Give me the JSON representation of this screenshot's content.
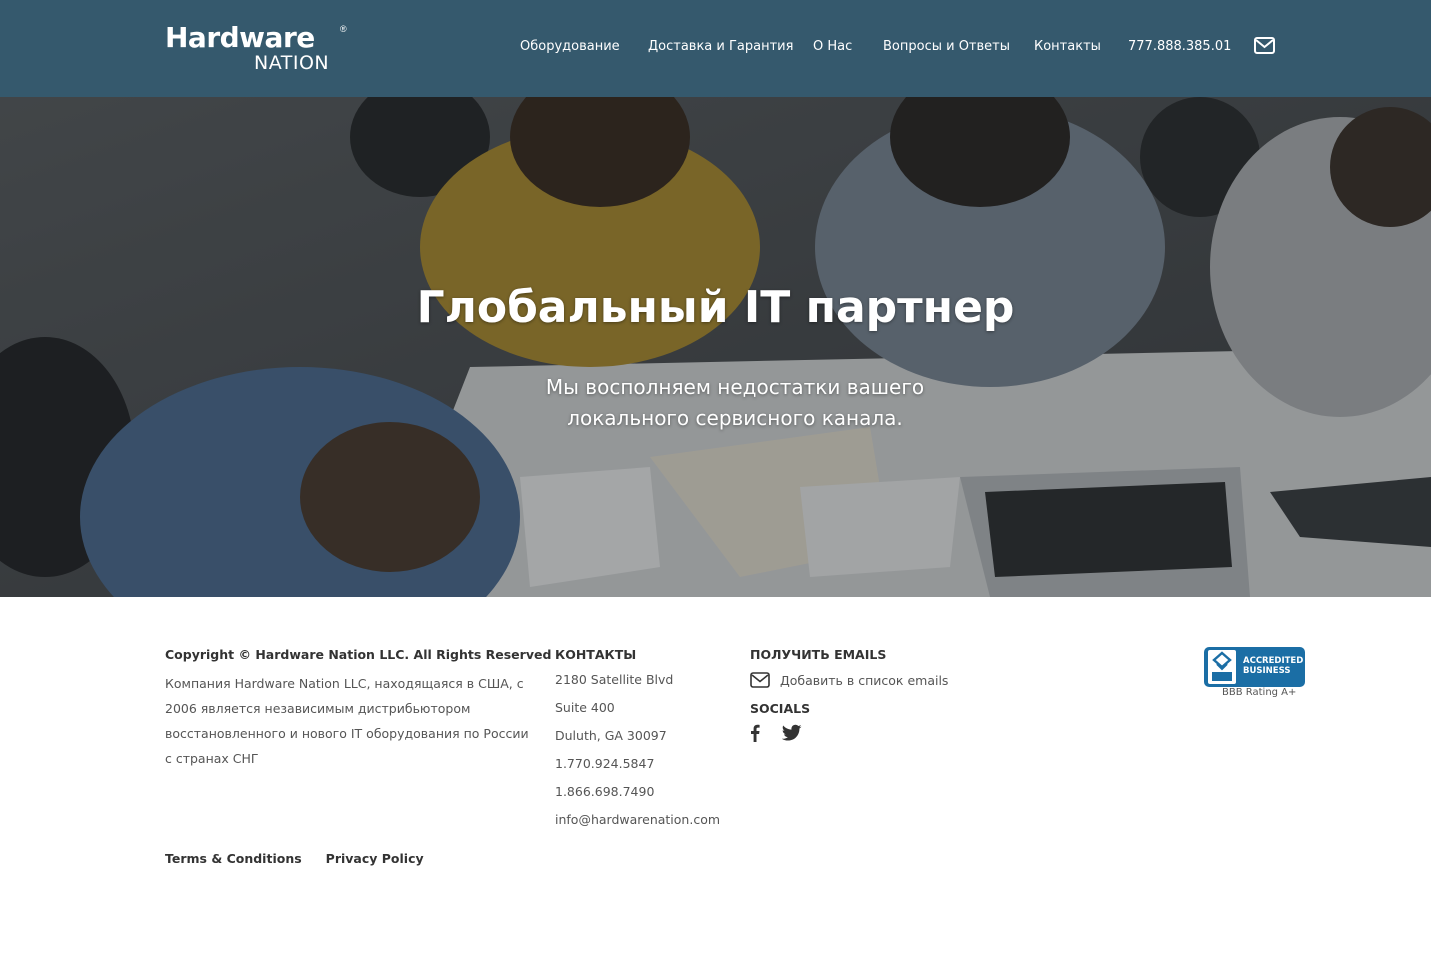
{
  "header": {
    "logo_main": "Hardware",
    "logo_sub": "NATION",
    "logo_reg": "®",
    "nav": [
      "Оборудование",
      "Доставка и Гарантия",
      "О Нас",
      "Вопросы и Ответы",
      "Контакты"
    ],
    "phone": "777.888.385.01",
    "mail_icon": "envelope-icon"
  },
  "hero": {
    "title": "Глобальный IT партнер",
    "subtitle": "Мы восполняем недостатки вашего локального сервисного канала."
  },
  "footer": {
    "copyright": "Copyright © Hardware Nation LLC. All Rights Reserved",
    "about": "Компания Hardware Nation LLC, находящаяся в США, с 2006 является независимым дистрибьютором восстановленного и нового IT оборудования по России с странах СНГ",
    "contacts_heading": "КОНТАКТЫ",
    "contacts": [
      "2180 Satellite Blvd",
      "Suite 400",
      "Duluth, GA 30097",
      "1.770.924.5847",
      "1.866.698.7490",
      "info@hardwarenation.com"
    ],
    "emails_heading": "ПОЛУЧИТЬ EMAILS",
    "add_email": "Добавить в список emails",
    "socials_heading": "SOCIALS",
    "socials": [
      "facebook-icon",
      "twitter-icon"
    ],
    "links": [
      "Terms & Conditions",
      "Privacy Policy"
    ],
    "bbb": {
      "line1": "ACCREDITED",
      "line2": "BUSINESS",
      "seal": "BBB",
      "rating": "BBB Rating A+"
    }
  },
  "colors": {
    "header_bg": "#35596d",
    "bbb_blue": "#1b6ea5"
  }
}
